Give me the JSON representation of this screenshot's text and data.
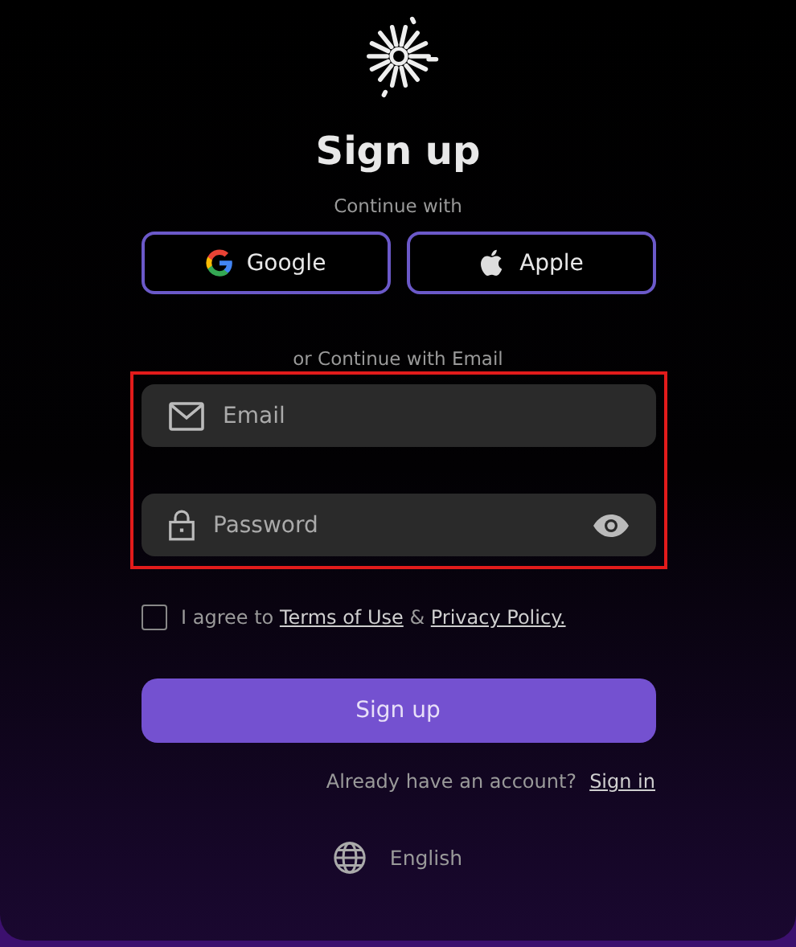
{
  "title": "Sign up",
  "continue_label": "Continue with",
  "social_buttons": [
    {
      "kind": "google",
      "label": "Google"
    },
    {
      "kind": "apple",
      "label": "Apple"
    }
  ],
  "email_label": "or Continue with Email",
  "fields_highlighted": true,
  "fields": [
    {
      "kind": "email",
      "placeholder": "Email"
    },
    {
      "kind": "password",
      "placeholder": "Password"
    }
  ],
  "agreement": {
    "checked": false,
    "prefix": "I agree to",
    "terms_link": "Terms of Use",
    "joiner": "&",
    "privacy_link": "Privacy Policy."
  },
  "submit": "Sign up",
  "signin_prompt": "Already have an account?",
  "signin_link": "Sign in",
  "language": "English"
}
